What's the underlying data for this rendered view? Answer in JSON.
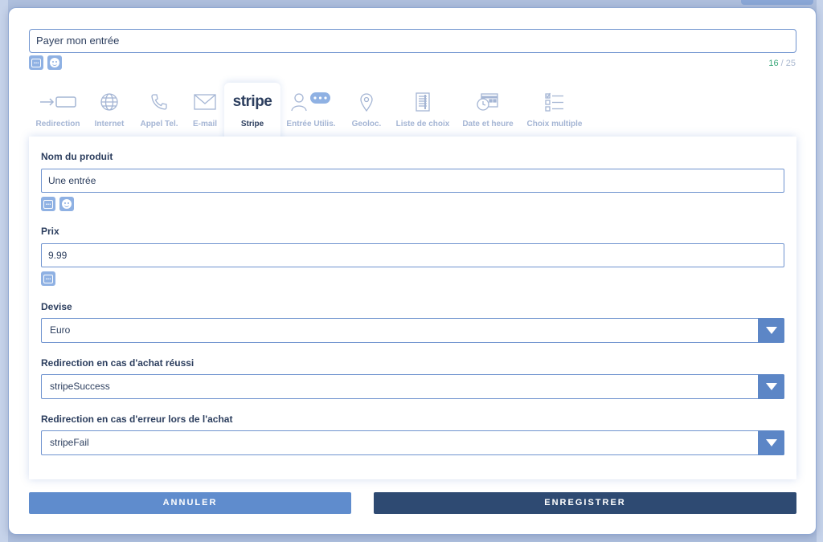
{
  "header": {
    "title_value": "Payer mon entrée",
    "counter_current": "16",
    "counter_sep": " / ",
    "counter_max": "25"
  },
  "tabs": [
    {
      "label": "Redirection",
      "icon": "arrow-redirect-icon"
    },
    {
      "label": "Internet",
      "icon": "globe-icon"
    },
    {
      "label": "Appel Tel.",
      "icon": "phone-icon"
    },
    {
      "label": "E-mail",
      "icon": "envelope-icon"
    },
    {
      "label": "Stripe",
      "icon": "stripe-logo",
      "logo_text": "stripe",
      "active": true
    },
    {
      "label": "Entrée Utilis.",
      "icon": "user-input-icon"
    },
    {
      "label": "Geoloc.",
      "icon": "map-pin-icon"
    },
    {
      "label": "Liste de choix",
      "icon": "list-icon"
    },
    {
      "label": "Date et heure",
      "icon": "calendar-clock-icon"
    },
    {
      "label": "Choix multiple",
      "icon": "checklist-icon"
    }
  ],
  "form": {
    "product_label": "Nom du produit",
    "product_value": "Une entrée",
    "price_label": "Prix",
    "price_value": "9.99",
    "currency_label": "Devise",
    "currency_value": "Euro",
    "success_label": "Redirection en cas d'achat réussi",
    "success_value": "stripeSuccess",
    "error_label": "Redirection en cas d'erreur lors de l'achat",
    "error_value": "stripeFail"
  },
  "buttons": {
    "cancel": "ANNULER",
    "save": "ENREGISTRER"
  },
  "colors": {
    "accent": "#5f8ccd",
    "primary_dark": "#2e4a72",
    "counter_ok": "#3aa87a"
  }
}
